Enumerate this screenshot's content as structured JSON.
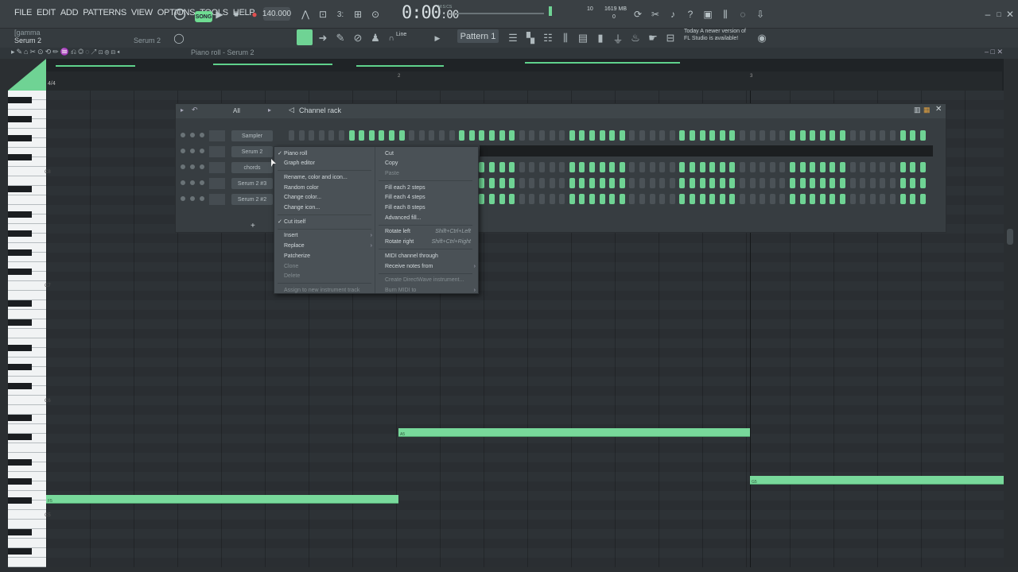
{
  "menu": [
    "FILE",
    "EDIT",
    "ADD",
    "PATTERNS",
    "VIEW",
    "OPTIONS",
    "TOOLS",
    "HELP"
  ],
  "transport": {
    "song_label": "SONG",
    "bpm": "140.000",
    "time_main": "0:00",
    "time_sub": "00",
    "time_caption": "M:S:CS"
  },
  "monitor": {
    "cpu": "10",
    "memory": "1619 MB",
    "voices": "0"
  },
  "hint": {
    "line1": "Today  A newer version of",
    "line2": "FL Studio is available!"
  },
  "channel_info": {
    "preset": "[gamma",
    "channel": "Serum 2",
    "channel2": "Serum 2"
  },
  "toolbar": {
    "snap": "Line",
    "pattern": "Pattern 1"
  },
  "piano_roll": {
    "title": "Piano roll - Serum 2",
    "timesig": "4/4",
    "bar_labels": [
      "2",
      "3"
    ],
    "octaves": [
      "C8",
      "C7",
      "C6",
      "C5"
    ],
    "notes": [
      {
        "label": "A5"
      },
      {
        "label": "G5"
      },
      {
        "label": "F5"
      }
    ]
  },
  "channel_rack": {
    "title": "Channel rack",
    "filter": "All",
    "channels": [
      "Sampler",
      "Serum 2",
      "chords",
      "Serum 2 #3",
      "Serum 2 #2"
    ],
    "add_label": "+"
  },
  "context_menu": {
    "left": [
      {
        "label": "Piano roll",
        "checked": true
      },
      {
        "label": "Graph editor"
      },
      {
        "sep": true
      },
      {
        "label": "Rename, color and icon..."
      },
      {
        "label": "Random color"
      },
      {
        "label": "Change color..."
      },
      {
        "label": "Change icon..."
      },
      {
        "sep": true
      },
      {
        "label": "Cut itself",
        "checked": true
      },
      {
        "sep": true
      },
      {
        "label": "Insert",
        "sub": true
      },
      {
        "label": "Replace",
        "sub": true
      },
      {
        "label": "Patcherize"
      },
      {
        "label": "Clone",
        "disabled": true
      },
      {
        "label": "Delete",
        "disabled": true
      },
      {
        "sep": true
      },
      {
        "label": "Assign to new instrument track",
        "disabled": true
      }
    ],
    "right": [
      {
        "label": "Cut"
      },
      {
        "label": "Copy"
      },
      {
        "label": "Paste",
        "disabled": true
      },
      {
        "sep": true
      },
      {
        "label": "Fill each 2 steps"
      },
      {
        "label": "Fill each 4 steps"
      },
      {
        "label": "Fill each 8 steps"
      },
      {
        "label": "Advanced fill..."
      },
      {
        "sep": true
      },
      {
        "label": "Rotate left",
        "shortcut": "Shift+Ctrl+Left"
      },
      {
        "label": "Rotate right",
        "shortcut": "Shift+Ctrl+Right"
      },
      {
        "sep": true
      },
      {
        "label": "MIDI channel through"
      },
      {
        "label": "Receive notes from",
        "sub": true
      },
      {
        "sep": true
      },
      {
        "label": "Create DirectWave instrument...",
        "disabled": true
      },
      {
        "label": "Burn MIDI to",
        "sub": true,
        "disabled": true
      }
    ]
  },
  "colors": {
    "accent": "#6fd394",
    "background": "#2b2f32",
    "menu_bg": "#4a5156"
  }
}
